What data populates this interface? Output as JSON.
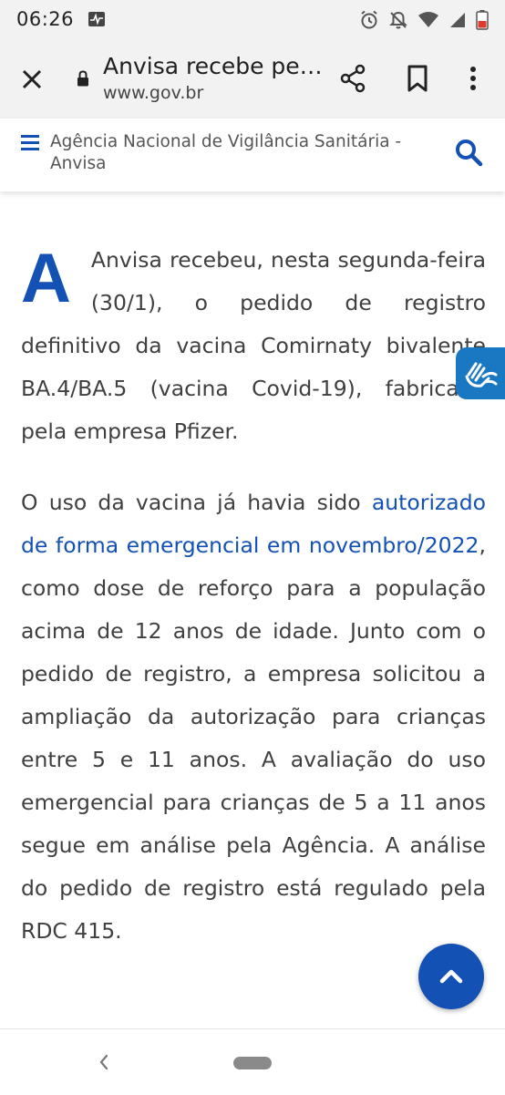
{
  "status_bar": {
    "time": "06:26",
    "icons": [
      "activity-icon",
      "alarm-icon",
      "notifications-off-icon",
      "wifi-icon",
      "signal-icon",
      "battery-icon"
    ]
  },
  "browser": {
    "page_title": "Anvisa recebe pe…",
    "url": "www.gov.br",
    "icons": [
      "close-icon",
      "lock-icon",
      "share-icon",
      "bookmark-icon",
      "more-vert-icon"
    ]
  },
  "site_header": {
    "name": "Agência Nacional de Vigilância Sanitária - Anvisa",
    "icons": [
      "menu-icon",
      "search-icon"
    ]
  },
  "article": {
    "drop_cap": "A",
    "p1": "Anvisa recebeu, nesta segunda-feira (30/1), o pedido de registro definitivo da vacina Comirnaty bivalente BA.4/BA.5 (vacina Covid-19), fabricada pela empresa Pfizer.",
    "p2_before": "O uso da vacina já havia sido ",
    "p2_link": "autorizado de forma emergencial em novembro/2022",
    "p2_after": ", como dose de reforço para a população acima de 12 anos de idade. Junto com o pedido de registro, a empresa solicitou a ampliação da autorização para crianças entre 5 e 11 anos. A avaliação do uso emergencial para crianças de 5 a 11 anos  segue em análise pela Agência. A análise do pedido de registro está regulado pela RDC 415."
  },
  "floating": {
    "accessibility_icon": "sign-language-icon",
    "back_to_top_icon": "chevron-up-icon"
  },
  "colors": {
    "accent": "#1351b4",
    "vlibras": "#1a78c2",
    "toolbar_bg": "#f2f2f2"
  }
}
